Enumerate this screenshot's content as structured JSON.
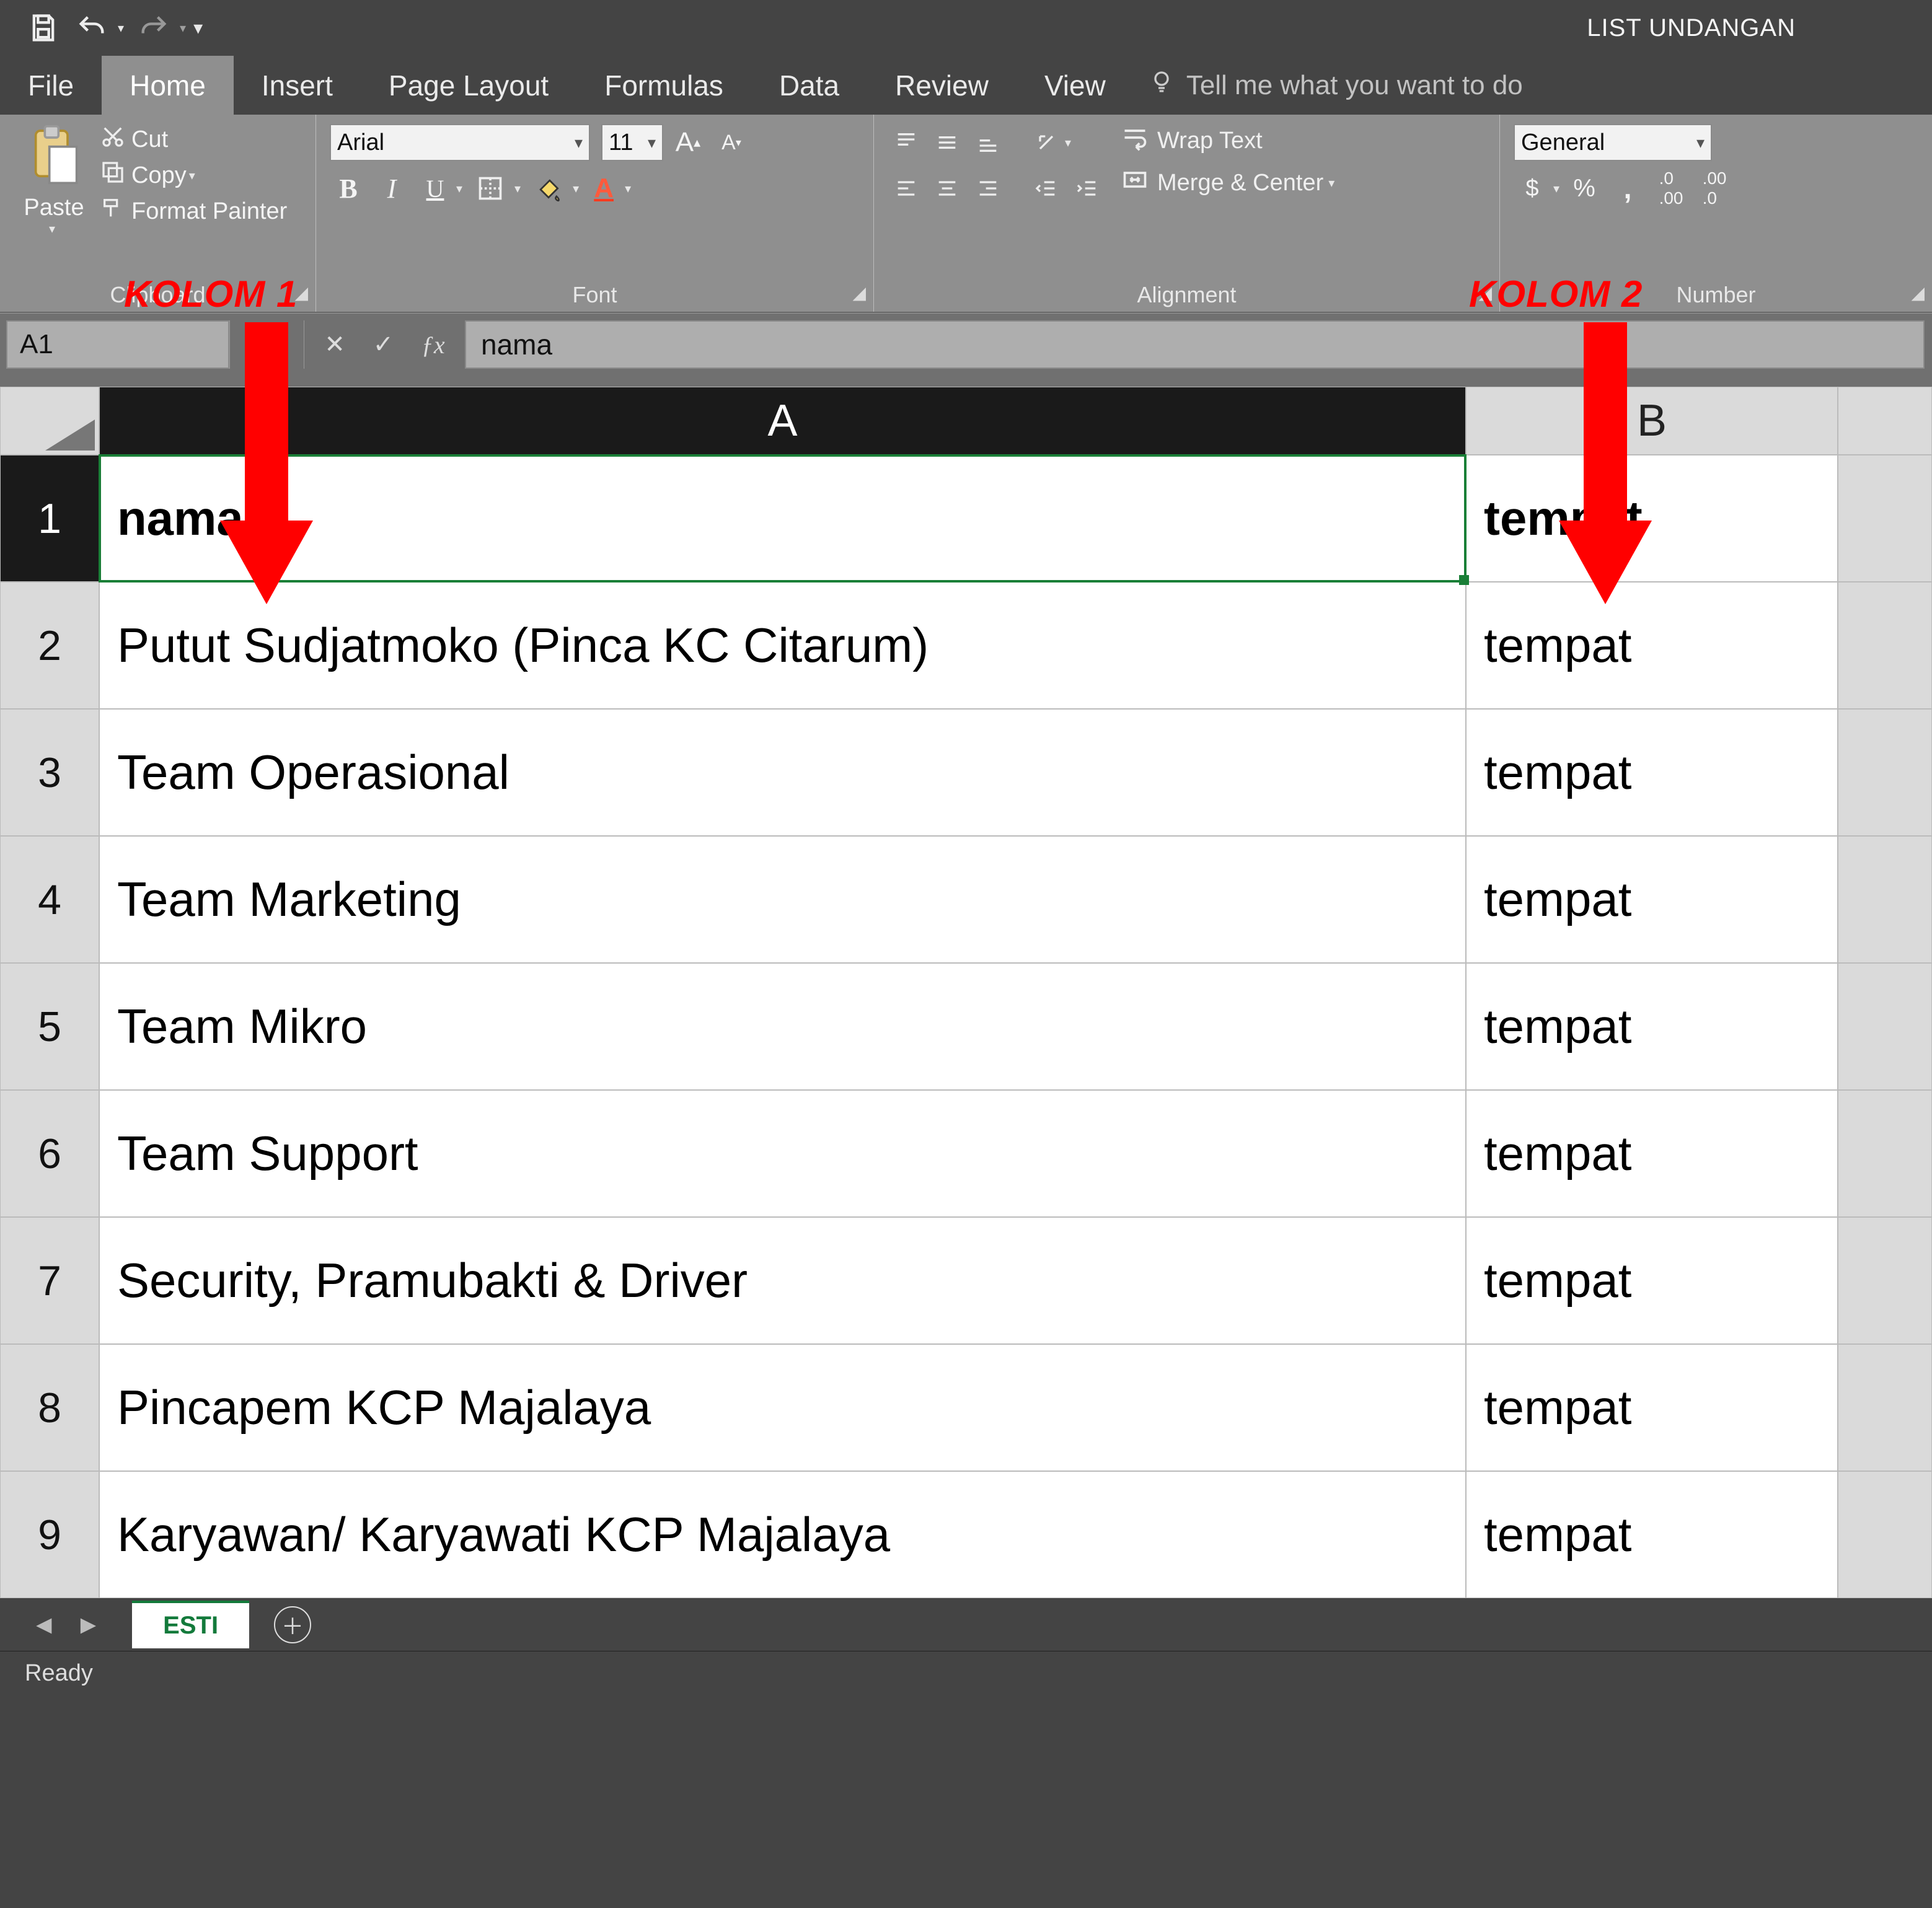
{
  "titlebar": {
    "doc_title": "LIST UNDANGAN"
  },
  "tabs": {
    "file": "File",
    "home": "Home",
    "insert": "Insert",
    "page_layout": "Page Layout",
    "formulas": "Formulas",
    "data": "Data",
    "review": "Review",
    "view": "View",
    "tell_me": "Tell me what you want to do"
  },
  "ribbon": {
    "clipboard": {
      "paste": "Paste",
      "cut": "Cut",
      "copy": "Copy",
      "format_painter": "Format Painter",
      "label": "Clipboard"
    },
    "font": {
      "name": "Arial",
      "size": "11",
      "bold": "B",
      "italic": "I",
      "underline": "U",
      "label": "Font"
    },
    "alignment": {
      "wrap": "Wrap Text",
      "merge": "Merge & Center",
      "label": "Alignment"
    },
    "number": {
      "format": "General",
      "label": "Number"
    }
  },
  "formula_bar": {
    "name_box": "A1",
    "value": "nama"
  },
  "columns": {
    "A": "A",
    "B": "B"
  },
  "rows": [
    "1",
    "2",
    "3",
    "4",
    "5",
    "6",
    "7",
    "8",
    "9"
  ],
  "cells": {
    "A1": "nama",
    "B1": "tempat",
    "A2": "Putut Sudjatmoko (Pinca KC Citarum)",
    "B2": "tempat",
    "A3": "Team Operasional",
    "B3": "tempat",
    "A4": "Team Marketing",
    "B4": "tempat",
    "A5": "Team Mikro",
    "B5": "tempat",
    "A6": "Team Support",
    "B6": "tempat",
    "A7": "Security, Pramubakti & Driver",
    "B7": "tempat",
    "A8": "Pincapem KCP Majalaya",
    "B8": "tempat",
    "A9": "Karyawan/ Karyawati KCP Majalaya",
    "B9": "tempat"
  },
  "sheet_tabs": {
    "active": "ESTI"
  },
  "status": "Ready",
  "annotations": {
    "kolom1": "KOLOM 1",
    "kolom2": "KOLOM 2"
  }
}
